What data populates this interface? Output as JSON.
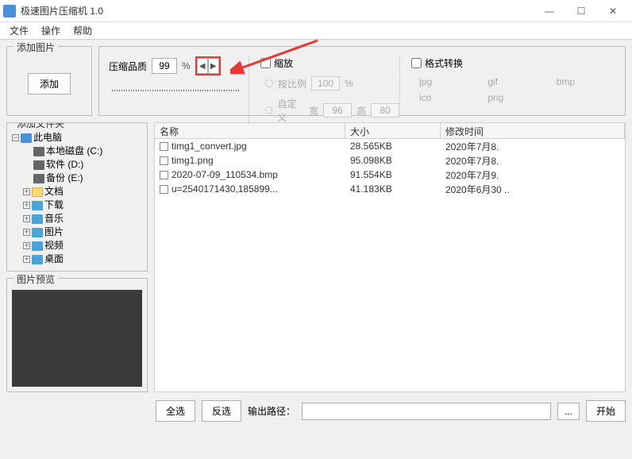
{
  "window": {
    "title": "极速图片压缩机 1.0",
    "min_glyph": "—",
    "max_glyph": "☐",
    "close_glyph": "✕"
  },
  "menu": {
    "file": "文件",
    "operate": "操作",
    "help": "帮助"
  },
  "add_panel": {
    "legend": "添加图片",
    "button": "添加"
  },
  "quality": {
    "label": "压缩品质",
    "value": "99",
    "unit": "%",
    "dec": "◀",
    "inc": "▶"
  },
  "scale": {
    "checkbox_label": "缩放",
    "by_ratio_label": "按比例",
    "ratio_value": "100",
    "ratio_unit": "%",
    "custom_label": "自定义",
    "width_label": "宽",
    "width_value": "96",
    "height_label": "高",
    "height_value": "80"
  },
  "format": {
    "checkbox_label": "格式转换",
    "jpg": "jpg",
    "gif": "gif",
    "bmp": "bmp",
    "ico": "ico",
    "png": "png"
  },
  "tree_panel": {
    "legend": "添加文件夹"
  },
  "tree": {
    "root": "此电脑",
    "n0": "本地磁盘 (C:)",
    "n1": "软件 (D:)",
    "n2": "备份 (E:)",
    "n3": "文档",
    "n4": "下载",
    "n5": "音乐",
    "n6": "图片",
    "n7": "视频",
    "n8": "桌面",
    "minus": "−",
    "plus": "+"
  },
  "preview_panel": {
    "legend": "图片预览"
  },
  "columns": {
    "name": "名称",
    "size": "大小",
    "date": "修改时间"
  },
  "files": [
    {
      "name": "timg1_convert.jpg",
      "size": "28.565KB",
      "date": "2020年7月8."
    },
    {
      "name": "timg1.png",
      "size": "95.098KB",
      "date": "2020年7月8."
    },
    {
      "name": "2020-07-09_110534.bmp",
      "size": "91.554KB",
      "date": "2020年7月9."
    },
    {
      "name": "u=2540171430,185899...",
      "size": "41.183KB",
      "date": "2020年6月30 .."
    }
  ],
  "bottom": {
    "select_all": "全选",
    "invert": "反选",
    "path_label": "输出路径：",
    "browse": "...",
    "start": "开始"
  }
}
